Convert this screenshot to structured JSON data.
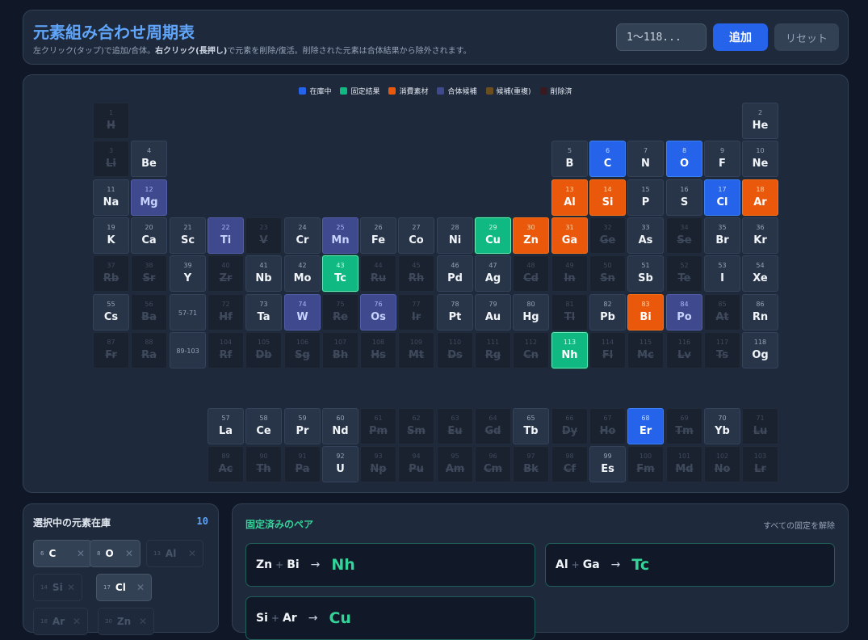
{
  "header": {
    "title": "元素組み合わせ周期表",
    "subtitle_a": "左クリック(タップ)で追加/合体。",
    "subtitle_b": "右クリック(長押し)",
    "subtitle_c": "で元素を削除/復活。削除された元素は合体結果から除外されます。",
    "input_placeholder": "1〜118...",
    "add_label": "追加",
    "reset_label": "リセット"
  },
  "legend": [
    {
      "label": "在庫中",
      "color": "#2563eb"
    },
    {
      "label": "固定結果",
      "color": "#10b981"
    },
    {
      "label": "消費素材",
      "color": "#ea580c"
    },
    {
      "label": "合体候補",
      "color": "#3f4a8e"
    },
    {
      "label": "候補(重複)",
      "color": "#6b4e1f"
    },
    {
      "label": "削除済",
      "color": "#3a1a1e"
    }
  ],
  "main_rows": [
    [
      [
        "1",
        "H",
        "removed"
      ],
      null,
      null,
      null,
      null,
      null,
      null,
      null,
      null,
      null,
      null,
      null,
      null,
      null,
      null,
      null,
      null,
      [
        "2",
        "He",
        "normal"
      ]
    ],
    [
      [
        "3",
        "Li",
        "removed"
      ],
      [
        "4",
        "Be",
        "normal"
      ],
      null,
      null,
      null,
      null,
      null,
      null,
      null,
      null,
      null,
      null,
      [
        "5",
        "B",
        "normal"
      ],
      [
        "6",
        "C",
        "stock"
      ],
      [
        "7",
        "N",
        "normal"
      ],
      [
        "8",
        "O",
        "stock"
      ],
      [
        "9",
        "F",
        "normal"
      ],
      [
        "10",
        "Ne",
        "normal"
      ]
    ],
    [
      [
        "11",
        "Na",
        "normal"
      ],
      [
        "12",
        "Mg",
        "cand"
      ],
      null,
      null,
      null,
      null,
      null,
      null,
      null,
      null,
      null,
      null,
      [
        "13",
        "Al",
        "consumed"
      ],
      [
        "14",
        "Si",
        "consumed"
      ],
      [
        "15",
        "P",
        "normal"
      ],
      [
        "16",
        "S",
        "normal"
      ],
      [
        "17",
        "Cl",
        "stock"
      ],
      [
        "18",
        "Ar",
        "consumed"
      ]
    ],
    [
      [
        "19",
        "K",
        "normal"
      ],
      [
        "20",
        "Ca",
        "normal"
      ],
      [
        "21",
        "Sc",
        "normal"
      ],
      [
        "22",
        "Ti",
        "cand"
      ],
      [
        "23",
        "V",
        "removed"
      ],
      [
        "24",
        "Cr",
        "normal"
      ],
      [
        "25",
        "Mn",
        "cand"
      ],
      [
        "26",
        "Fe",
        "normal"
      ],
      [
        "27",
        "Co",
        "normal"
      ],
      [
        "28",
        "Ni",
        "normal"
      ],
      [
        "29",
        "Cu",
        "fixed"
      ],
      [
        "30",
        "Zn",
        "consumed"
      ],
      [
        "31",
        "Ga",
        "consumed"
      ],
      [
        "32",
        "Ge",
        "removed"
      ],
      [
        "33",
        "As",
        "normal"
      ],
      [
        "34",
        "Se",
        "removed"
      ],
      [
        "35",
        "Br",
        "normal"
      ],
      [
        "36",
        "Kr",
        "normal"
      ]
    ],
    [
      [
        "37",
        "Rb",
        "removed"
      ],
      [
        "38",
        "Sr",
        "removed"
      ],
      [
        "39",
        "Y",
        "normal"
      ],
      [
        "40",
        "Zr",
        "removed"
      ],
      [
        "41",
        "Nb",
        "normal"
      ],
      [
        "42",
        "Mo",
        "normal"
      ],
      [
        "43",
        "Tc",
        "fixed"
      ],
      [
        "44",
        "Ru",
        "removed"
      ],
      [
        "45",
        "Rh",
        "removed"
      ],
      [
        "46",
        "Pd",
        "normal"
      ],
      [
        "47",
        "Ag",
        "normal"
      ],
      [
        "48",
        "Cd",
        "removed"
      ],
      [
        "49",
        "In",
        "removed"
      ],
      [
        "50",
        "Sn",
        "removed"
      ],
      [
        "51",
        "Sb",
        "normal"
      ],
      [
        "52",
        "Te",
        "removed"
      ],
      [
        "53",
        "I",
        "normal"
      ],
      [
        "54",
        "Xe",
        "normal"
      ]
    ],
    [
      [
        "55",
        "Cs",
        "normal"
      ],
      [
        "56",
        "Ba",
        "removed"
      ],
      [
        "",
        "57-71",
        "range"
      ],
      [
        "72",
        "Hf",
        "removed"
      ],
      [
        "73",
        "Ta",
        "normal"
      ],
      [
        "74",
        "W",
        "cand"
      ],
      [
        "75",
        "Re",
        "removed"
      ],
      [
        "76",
        "Os",
        "cand"
      ],
      [
        "77",
        "Ir",
        "removed"
      ],
      [
        "78",
        "Pt",
        "normal"
      ],
      [
        "79",
        "Au",
        "normal"
      ],
      [
        "80",
        "Hg",
        "normal"
      ],
      [
        "81",
        "Tl",
        "removed"
      ],
      [
        "82",
        "Pb",
        "normal"
      ],
      [
        "83",
        "Bi",
        "consumed"
      ],
      [
        "84",
        "Po",
        "cand"
      ],
      [
        "85",
        "At",
        "removed"
      ],
      [
        "86",
        "Rn",
        "normal"
      ]
    ],
    [
      [
        "87",
        "Fr",
        "removed"
      ],
      [
        "88",
        "Ra",
        "removed"
      ],
      [
        "",
        "89-103",
        "range"
      ],
      [
        "104",
        "Rf",
        "removed"
      ],
      [
        "105",
        "Db",
        "removed"
      ],
      [
        "106",
        "Sg",
        "removed"
      ],
      [
        "107",
        "Bh",
        "removed"
      ],
      [
        "108",
        "Hs",
        "removed"
      ],
      [
        "109",
        "Mt",
        "removed"
      ],
      [
        "110",
        "Ds",
        "removed"
      ],
      [
        "111",
        "Rg",
        "removed"
      ],
      [
        "112",
        "Cn",
        "removed"
      ],
      [
        "113",
        "Nh",
        "fixed"
      ],
      [
        "114",
        "Fl",
        "removed"
      ],
      [
        "115",
        "Mc",
        "removed"
      ],
      [
        "116",
        "Lv",
        "removed"
      ],
      [
        "117",
        "Ts",
        "removed"
      ],
      [
        "118",
        "Og",
        "normal"
      ]
    ]
  ],
  "f_rows": [
    [
      [
        "57",
        "La",
        "normal"
      ],
      [
        "58",
        "Ce",
        "normal"
      ],
      [
        "59",
        "Pr",
        "normal"
      ],
      [
        "60",
        "Nd",
        "normal"
      ],
      [
        "61",
        "Pm",
        "removed"
      ],
      [
        "62",
        "Sm",
        "removed"
      ],
      [
        "63",
        "Eu",
        "removed"
      ],
      [
        "64",
        "Gd",
        "removed"
      ],
      [
        "65",
        "Tb",
        "normal"
      ],
      [
        "66",
        "Dy",
        "removed"
      ],
      [
        "67",
        "Ho",
        "removed"
      ],
      [
        "68",
        "Er",
        "stock"
      ],
      [
        "69",
        "Tm",
        "removed"
      ],
      [
        "70",
        "Yb",
        "normal"
      ],
      [
        "71",
        "Lu",
        "removed"
      ]
    ],
    [
      [
        "89",
        "Ac",
        "removed"
      ],
      [
        "90",
        "Th",
        "removed"
      ],
      [
        "91",
        "Pa",
        "removed"
      ],
      [
        "92",
        "U",
        "normal"
      ],
      [
        "93",
        "Np",
        "removed"
      ],
      [
        "94",
        "Pu",
        "removed"
      ],
      [
        "95",
        "Am",
        "removed"
      ],
      [
        "96",
        "Cm",
        "removed"
      ],
      [
        "97",
        "Bk",
        "removed"
      ],
      [
        "98",
        "Cf",
        "removed"
      ],
      [
        "99",
        "Es",
        "normal"
      ],
      [
        "100",
        "Fm",
        "removed"
      ],
      [
        "101",
        "Md",
        "removed"
      ],
      [
        "102",
        "No",
        "removed"
      ],
      [
        "103",
        "Lr",
        "removed"
      ]
    ]
  ],
  "inventory": {
    "title": "選択中の元素在庫",
    "count": "10",
    "close_glyph": "✕",
    "chips": [
      {
        "num": "6",
        "sym": "C",
        "active": true
      },
      {
        "num": "8",
        "sym": "O",
        "active": true
      },
      {
        "num": "13",
        "sym": "Al",
        "active": false
      },
      {
        "num": "14",
        "sym": "Si",
        "active": false
      },
      {
        "num": "17",
        "sym": "Cl",
        "active": true
      },
      {
        "num": "18",
        "sym": "Ar",
        "active": false
      },
      {
        "num": "30",
        "sym": "Zn",
        "active": false
      }
    ]
  },
  "pairs": {
    "title": "固定済みのペア",
    "clear_label": "すべての固定を解除",
    "plus": "+",
    "arrow": "→",
    "items": [
      {
        "a": "Zn",
        "b": "Bi",
        "result": "Nh"
      },
      {
        "a": "Al",
        "b": "Ga",
        "result": "Tc"
      },
      {
        "a": "Si",
        "b": "Ar",
        "result": "Cu"
      }
    ]
  }
}
